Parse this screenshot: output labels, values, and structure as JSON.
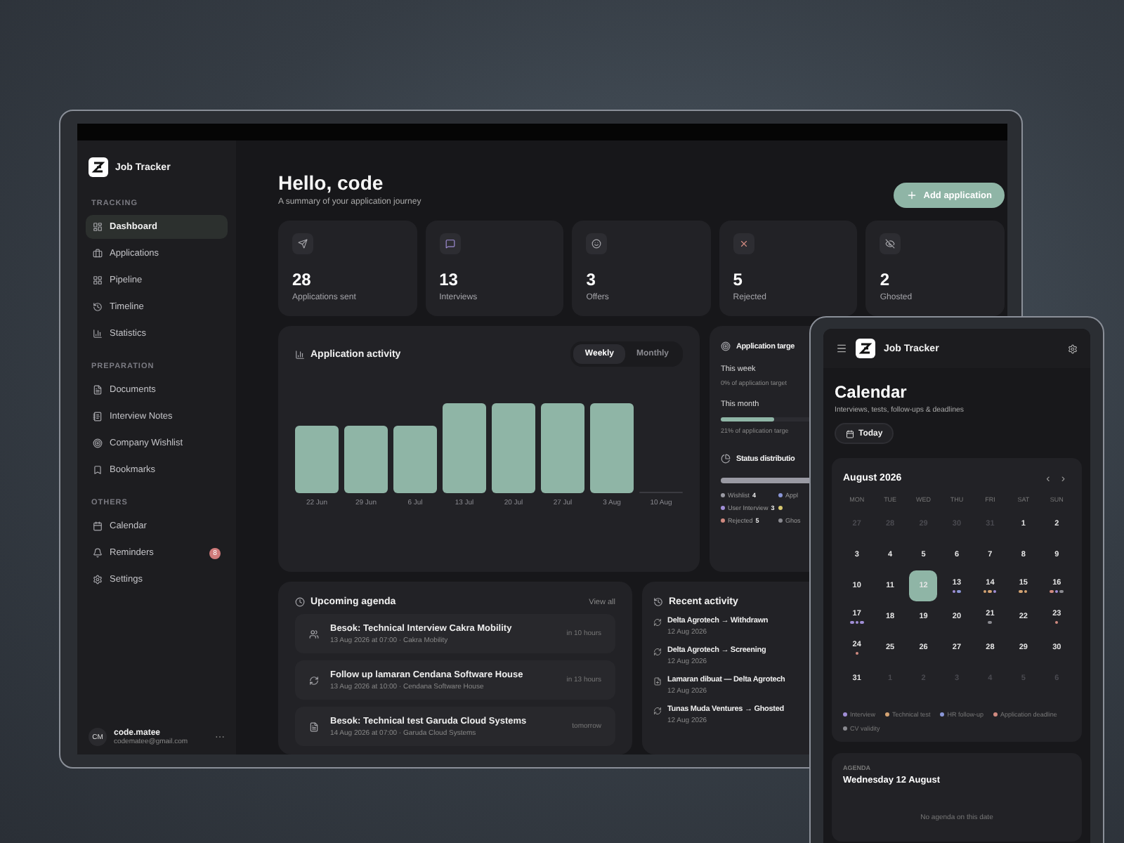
{
  "app": {
    "name": "Job Tracker"
  },
  "sidebar": {
    "sections": [
      {
        "title": "TRACKING",
        "items": [
          {
            "label": "Dashboard",
            "selected": true
          },
          {
            "label": "Applications",
            "selected": false
          },
          {
            "label": "Pipeline",
            "selected": false
          },
          {
            "label": "Timeline",
            "selected": false
          },
          {
            "label": "Statistics",
            "selected": false
          }
        ]
      },
      {
        "title": "PREPARATION",
        "items": [
          {
            "label": "Documents",
            "selected": false
          },
          {
            "label": "Interview Notes",
            "selected": false
          },
          {
            "label": "Company Wishlist",
            "selected": false
          },
          {
            "label": "Bookmarks",
            "selected": false
          }
        ]
      },
      {
        "title": "OTHERS",
        "items": [
          {
            "label": "Calendar",
            "selected": false
          },
          {
            "label": "Reminders",
            "selected": false,
            "badge": "8"
          },
          {
            "label": "Settings",
            "selected": false
          }
        ]
      }
    ],
    "user": {
      "initials": "CM",
      "name": "code.matee",
      "email": "codematee@gmail.com",
      "menu": "⋯"
    }
  },
  "header": {
    "title": "Hello, code",
    "subtitle": "A summary of your application journey",
    "button": "Add application"
  },
  "stats": [
    {
      "value": "28",
      "label": "Applications sent"
    },
    {
      "value": "13",
      "label": "Interviews"
    },
    {
      "value": "3",
      "label": "Offers"
    },
    {
      "value": "5",
      "label": "Rejected"
    },
    {
      "value": "2",
      "label": "Ghosted"
    }
  ],
  "activity": {
    "title": "Application activity",
    "tabs": [
      {
        "label": "Weekly",
        "selected": true
      },
      {
        "label": "Monthly",
        "selected": false
      }
    ],
    "x_labels": [
      "22 Jun",
      "29 Jun",
      "6 Jul",
      "13 Jul",
      "20 Jul",
      "27 Jul",
      "3 Aug",
      "10 Aug"
    ]
  },
  "targets": {
    "title": "Application targe",
    "rows": [
      {
        "label": "This week",
        "note": "0% of application target",
        "level": 0
      },
      {
        "label": "This month",
        "note": "21% of application targe",
        "level": 0.21
      }
    ]
  },
  "status": {
    "title": "Status distributio",
    "legend": [
      {
        "label": "Wishlist",
        "count": "4",
        "color": "#9a9aa3"
      },
      {
        "label": "Appl",
        "color": "#8a96d6"
      },
      {
        "label": "User Interview",
        "count": "3",
        "color": "#a08ed6"
      },
      {
        "color": "#d8c870"
      },
      {
        "label": "Rejected",
        "count": "5",
        "color": "#d08a80"
      },
      {
        "label": "Ghos",
        "color": "#8a8a90"
      }
    ]
  },
  "agenda": {
    "title": "Upcoming agenda",
    "link": "View all",
    "items": [
      {
        "title": "Besok: Technical Interview Cakra Mobility",
        "meta": "13 Aug 2026 at 07:00 · Cakra Mobility",
        "when": "in 10 hours"
      },
      {
        "title": "Follow up lamaran Cendana Software House",
        "meta": "13 Aug 2026 at 10:00 · Cendana Software House",
        "when": "in 13 hours"
      },
      {
        "title": "Besok: Technical test Garuda Cloud Systems",
        "meta": "14 Aug 2026 at 07:00 · Garuda Cloud Systems",
        "when": "tomorrow"
      }
    ]
  },
  "recent": {
    "title": "Recent activity",
    "items": [
      {
        "title": "Delta Agrotech → Withdrawn",
        "date": "12 Aug 2026"
      },
      {
        "title": "Delta Agrotech → Screening",
        "date": "12 Aug 2026"
      },
      {
        "title": "Lamaran dibuat — Delta Agrotech",
        "date": "12 Aug 2026"
      },
      {
        "title": "Tunas Muda Ventures → Ghosted",
        "date": "12 Aug 2026"
      }
    ]
  },
  "phone": {
    "app": "Job Tracker",
    "title": "Calendar",
    "subtitle": "Interviews, tests, follow-ups & deadlines",
    "today": "Today",
    "month": "August 2026",
    "prev": "‹",
    "next": "›",
    "weekdays": [
      "MON",
      "TUE",
      "WED",
      "THU",
      "FRI",
      "SAT",
      "SUN"
    ],
    "days": [
      {
        "n": "27",
        "muted": true,
        "selected": false
      },
      {
        "n": "28",
        "muted": true,
        "selected": false
      },
      {
        "n": "29",
        "muted": true,
        "selected": false
      },
      {
        "n": "30",
        "muted": true,
        "selected": false
      },
      {
        "n": "31",
        "muted": true,
        "selected": false
      },
      {
        "n": "1",
        "muted": false,
        "selected": false
      },
      {
        "n": "2",
        "muted": false,
        "selected": false
      },
      {
        "n": "3",
        "muted": false,
        "selected": false
      },
      {
        "n": "4",
        "muted": false,
        "selected": false
      },
      {
        "n": "5",
        "muted": false,
        "selected": false
      },
      {
        "n": "6",
        "muted": false,
        "selected": false
      },
      {
        "n": "7",
        "muted": false,
        "selected": false
      },
      {
        "n": "8",
        "muted": false,
        "selected": false
      },
      {
        "n": "9",
        "muted": false,
        "selected": false
      },
      {
        "n": "10",
        "muted": false,
        "selected": false
      },
      {
        "n": "11",
        "muted": false,
        "selected": false
      },
      {
        "n": "12",
        "muted": false,
        "selected": true
      },
      {
        "n": "13",
        "muted": false,
        "selected": false,
        "dots": [
          {
            "color": "#a08ed6"
          },
          {
            "color": "#8a96d6"
          }
        ]
      },
      {
        "n": "14",
        "muted": false,
        "selected": false,
        "dots": [
          {
            "color": "#d4a373"
          },
          {
            "color": "#d4a373"
          },
          {
            "color": "#a08ed6"
          }
        ]
      },
      {
        "n": "15",
        "muted": false,
        "selected": false,
        "dots": [
          {
            "color": "#d4a373"
          },
          {
            "color": "#d4a373"
          }
        ]
      },
      {
        "n": "16",
        "muted": false,
        "selected": false,
        "dots": [
          {
            "color": "#d08a80"
          },
          {
            "color": "#a08ed6"
          },
          {
            "color": "#8a8a90"
          }
        ]
      },
      {
        "n": "17",
        "muted": false,
        "selected": false,
        "dots": [
          {
            "color": "#a08ed6"
          },
          {
            "color": "#a08ed6"
          },
          {
            "color": "#a08ed6"
          }
        ]
      },
      {
        "n": "18",
        "muted": false,
        "selected": false
      },
      {
        "n": "19",
        "muted": false,
        "selected": false
      },
      {
        "n": "20",
        "muted": false,
        "selected": false
      },
      {
        "n": "21",
        "muted": false,
        "selected": false,
        "dots": [
          {
            "color": "#8a8a90"
          }
        ]
      },
      {
        "n": "22",
        "muted": false,
        "selected": false
      },
      {
        "n": "23",
        "muted": false,
        "selected": false,
        "dots": [
          {
            "color": "#d08a80"
          }
        ]
      },
      {
        "n": "24",
        "muted": false,
        "selected": false,
        "dots": [
          {
            "color": "#d08a80"
          }
        ]
      },
      {
        "n": "25",
        "muted": false,
        "selected": false
      },
      {
        "n": "26",
        "muted": false,
        "selected": false
      },
      {
        "n": "27",
        "muted": false,
        "selected": false
      },
      {
        "n": "28",
        "muted": false,
        "selected": false
      },
      {
        "n": "29",
        "muted": false,
        "selected": false
      },
      {
        "n": "30",
        "muted": false,
        "selected": false
      },
      {
        "n": "31",
        "muted": false,
        "selected": false
      },
      {
        "n": "1",
        "muted": true,
        "selected": false
      },
      {
        "n": "2",
        "muted": true,
        "selected": false
      },
      {
        "n": "3",
        "muted": true,
        "selected": false
      },
      {
        "n": "4",
        "muted": true,
        "selected": false
      },
      {
        "n": "5",
        "muted": true,
        "selected": false
      },
      {
        "n": "6",
        "muted": true,
        "selected": false
      }
    ],
    "legend": [
      {
        "label": "Interview",
        "color": "#a08ed6"
      },
      {
        "label": "Technical test",
        "color": "#d4a373"
      },
      {
        "label": "HR follow-up",
        "color": "#8a96d6"
      },
      {
        "label": "Application deadline",
        "color": "#d08a80"
      },
      {
        "label": "CV validity",
        "color": "#8a8a90"
      }
    ],
    "agenda": {
      "label": "AGENDA",
      "date": "Wednesday 12 August",
      "empty": "No agenda on this date"
    }
  }
}
